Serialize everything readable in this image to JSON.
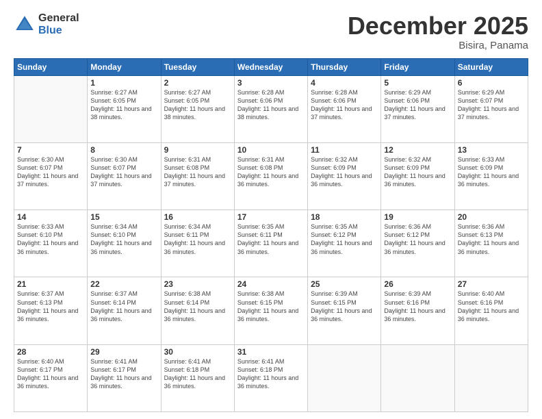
{
  "logo": {
    "general": "General",
    "blue": "Blue"
  },
  "header": {
    "month": "December 2025",
    "location": "Bisira, Panama"
  },
  "weekdays": [
    "Sunday",
    "Monday",
    "Tuesday",
    "Wednesday",
    "Thursday",
    "Friday",
    "Saturday"
  ],
  "weeks": [
    [
      {
        "day": "",
        "sunrise": "",
        "sunset": "",
        "daylight": ""
      },
      {
        "day": "1",
        "sunrise": "Sunrise: 6:27 AM",
        "sunset": "Sunset: 6:05 PM",
        "daylight": "Daylight: 11 hours and 38 minutes."
      },
      {
        "day": "2",
        "sunrise": "Sunrise: 6:27 AM",
        "sunset": "Sunset: 6:05 PM",
        "daylight": "Daylight: 11 hours and 38 minutes."
      },
      {
        "day": "3",
        "sunrise": "Sunrise: 6:28 AM",
        "sunset": "Sunset: 6:06 PM",
        "daylight": "Daylight: 11 hours and 38 minutes."
      },
      {
        "day": "4",
        "sunrise": "Sunrise: 6:28 AM",
        "sunset": "Sunset: 6:06 PM",
        "daylight": "Daylight: 11 hours and 37 minutes."
      },
      {
        "day": "5",
        "sunrise": "Sunrise: 6:29 AM",
        "sunset": "Sunset: 6:06 PM",
        "daylight": "Daylight: 11 hours and 37 minutes."
      },
      {
        "day": "6",
        "sunrise": "Sunrise: 6:29 AM",
        "sunset": "Sunset: 6:07 PM",
        "daylight": "Daylight: 11 hours and 37 minutes."
      }
    ],
    [
      {
        "day": "7",
        "sunrise": "Sunrise: 6:30 AM",
        "sunset": "Sunset: 6:07 PM",
        "daylight": "Daylight: 11 hours and 37 minutes."
      },
      {
        "day": "8",
        "sunrise": "Sunrise: 6:30 AM",
        "sunset": "Sunset: 6:07 PM",
        "daylight": "Daylight: 11 hours and 37 minutes."
      },
      {
        "day": "9",
        "sunrise": "Sunrise: 6:31 AM",
        "sunset": "Sunset: 6:08 PM",
        "daylight": "Daylight: 11 hours and 37 minutes."
      },
      {
        "day": "10",
        "sunrise": "Sunrise: 6:31 AM",
        "sunset": "Sunset: 6:08 PM",
        "daylight": "Daylight: 11 hours and 36 minutes."
      },
      {
        "day": "11",
        "sunrise": "Sunrise: 6:32 AM",
        "sunset": "Sunset: 6:09 PM",
        "daylight": "Daylight: 11 hours and 36 minutes."
      },
      {
        "day": "12",
        "sunrise": "Sunrise: 6:32 AM",
        "sunset": "Sunset: 6:09 PM",
        "daylight": "Daylight: 11 hours and 36 minutes."
      },
      {
        "day": "13",
        "sunrise": "Sunrise: 6:33 AM",
        "sunset": "Sunset: 6:09 PM",
        "daylight": "Daylight: 11 hours and 36 minutes."
      }
    ],
    [
      {
        "day": "14",
        "sunrise": "Sunrise: 6:33 AM",
        "sunset": "Sunset: 6:10 PM",
        "daylight": "Daylight: 11 hours and 36 minutes."
      },
      {
        "day": "15",
        "sunrise": "Sunrise: 6:34 AM",
        "sunset": "Sunset: 6:10 PM",
        "daylight": "Daylight: 11 hours and 36 minutes."
      },
      {
        "day": "16",
        "sunrise": "Sunrise: 6:34 AM",
        "sunset": "Sunset: 6:11 PM",
        "daylight": "Daylight: 11 hours and 36 minutes."
      },
      {
        "day": "17",
        "sunrise": "Sunrise: 6:35 AM",
        "sunset": "Sunset: 6:11 PM",
        "daylight": "Daylight: 11 hours and 36 minutes."
      },
      {
        "day": "18",
        "sunrise": "Sunrise: 6:35 AM",
        "sunset": "Sunset: 6:12 PM",
        "daylight": "Daylight: 11 hours and 36 minutes."
      },
      {
        "day": "19",
        "sunrise": "Sunrise: 6:36 AM",
        "sunset": "Sunset: 6:12 PM",
        "daylight": "Daylight: 11 hours and 36 minutes."
      },
      {
        "day": "20",
        "sunrise": "Sunrise: 6:36 AM",
        "sunset": "Sunset: 6:13 PM",
        "daylight": "Daylight: 11 hours and 36 minutes."
      }
    ],
    [
      {
        "day": "21",
        "sunrise": "Sunrise: 6:37 AM",
        "sunset": "Sunset: 6:13 PM",
        "daylight": "Daylight: 11 hours and 36 minutes."
      },
      {
        "day": "22",
        "sunrise": "Sunrise: 6:37 AM",
        "sunset": "Sunset: 6:14 PM",
        "daylight": "Daylight: 11 hours and 36 minutes."
      },
      {
        "day": "23",
        "sunrise": "Sunrise: 6:38 AM",
        "sunset": "Sunset: 6:14 PM",
        "daylight": "Daylight: 11 hours and 36 minutes."
      },
      {
        "day": "24",
        "sunrise": "Sunrise: 6:38 AM",
        "sunset": "Sunset: 6:15 PM",
        "daylight": "Daylight: 11 hours and 36 minutes."
      },
      {
        "day": "25",
        "sunrise": "Sunrise: 6:39 AM",
        "sunset": "Sunset: 6:15 PM",
        "daylight": "Daylight: 11 hours and 36 minutes."
      },
      {
        "day": "26",
        "sunrise": "Sunrise: 6:39 AM",
        "sunset": "Sunset: 6:16 PM",
        "daylight": "Daylight: 11 hours and 36 minutes."
      },
      {
        "day": "27",
        "sunrise": "Sunrise: 6:40 AM",
        "sunset": "Sunset: 6:16 PM",
        "daylight": "Daylight: 11 hours and 36 minutes."
      }
    ],
    [
      {
        "day": "28",
        "sunrise": "Sunrise: 6:40 AM",
        "sunset": "Sunset: 6:17 PM",
        "daylight": "Daylight: 11 hours and 36 minutes."
      },
      {
        "day": "29",
        "sunrise": "Sunrise: 6:41 AM",
        "sunset": "Sunset: 6:17 PM",
        "daylight": "Daylight: 11 hours and 36 minutes."
      },
      {
        "day": "30",
        "sunrise": "Sunrise: 6:41 AM",
        "sunset": "Sunset: 6:18 PM",
        "daylight": "Daylight: 11 hours and 36 minutes."
      },
      {
        "day": "31",
        "sunrise": "Sunrise: 6:41 AM",
        "sunset": "Sunset: 6:18 PM",
        "daylight": "Daylight: 11 hours and 36 minutes."
      },
      {
        "day": "",
        "sunrise": "",
        "sunset": "",
        "daylight": ""
      },
      {
        "day": "",
        "sunrise": "",
        "sunset": "",
        "daylight": ""
      },
      {
        "day": "",
        "sunrise": "",
        "sunset": "",
        "daylight": ""
      }
    ]
  ]
}
